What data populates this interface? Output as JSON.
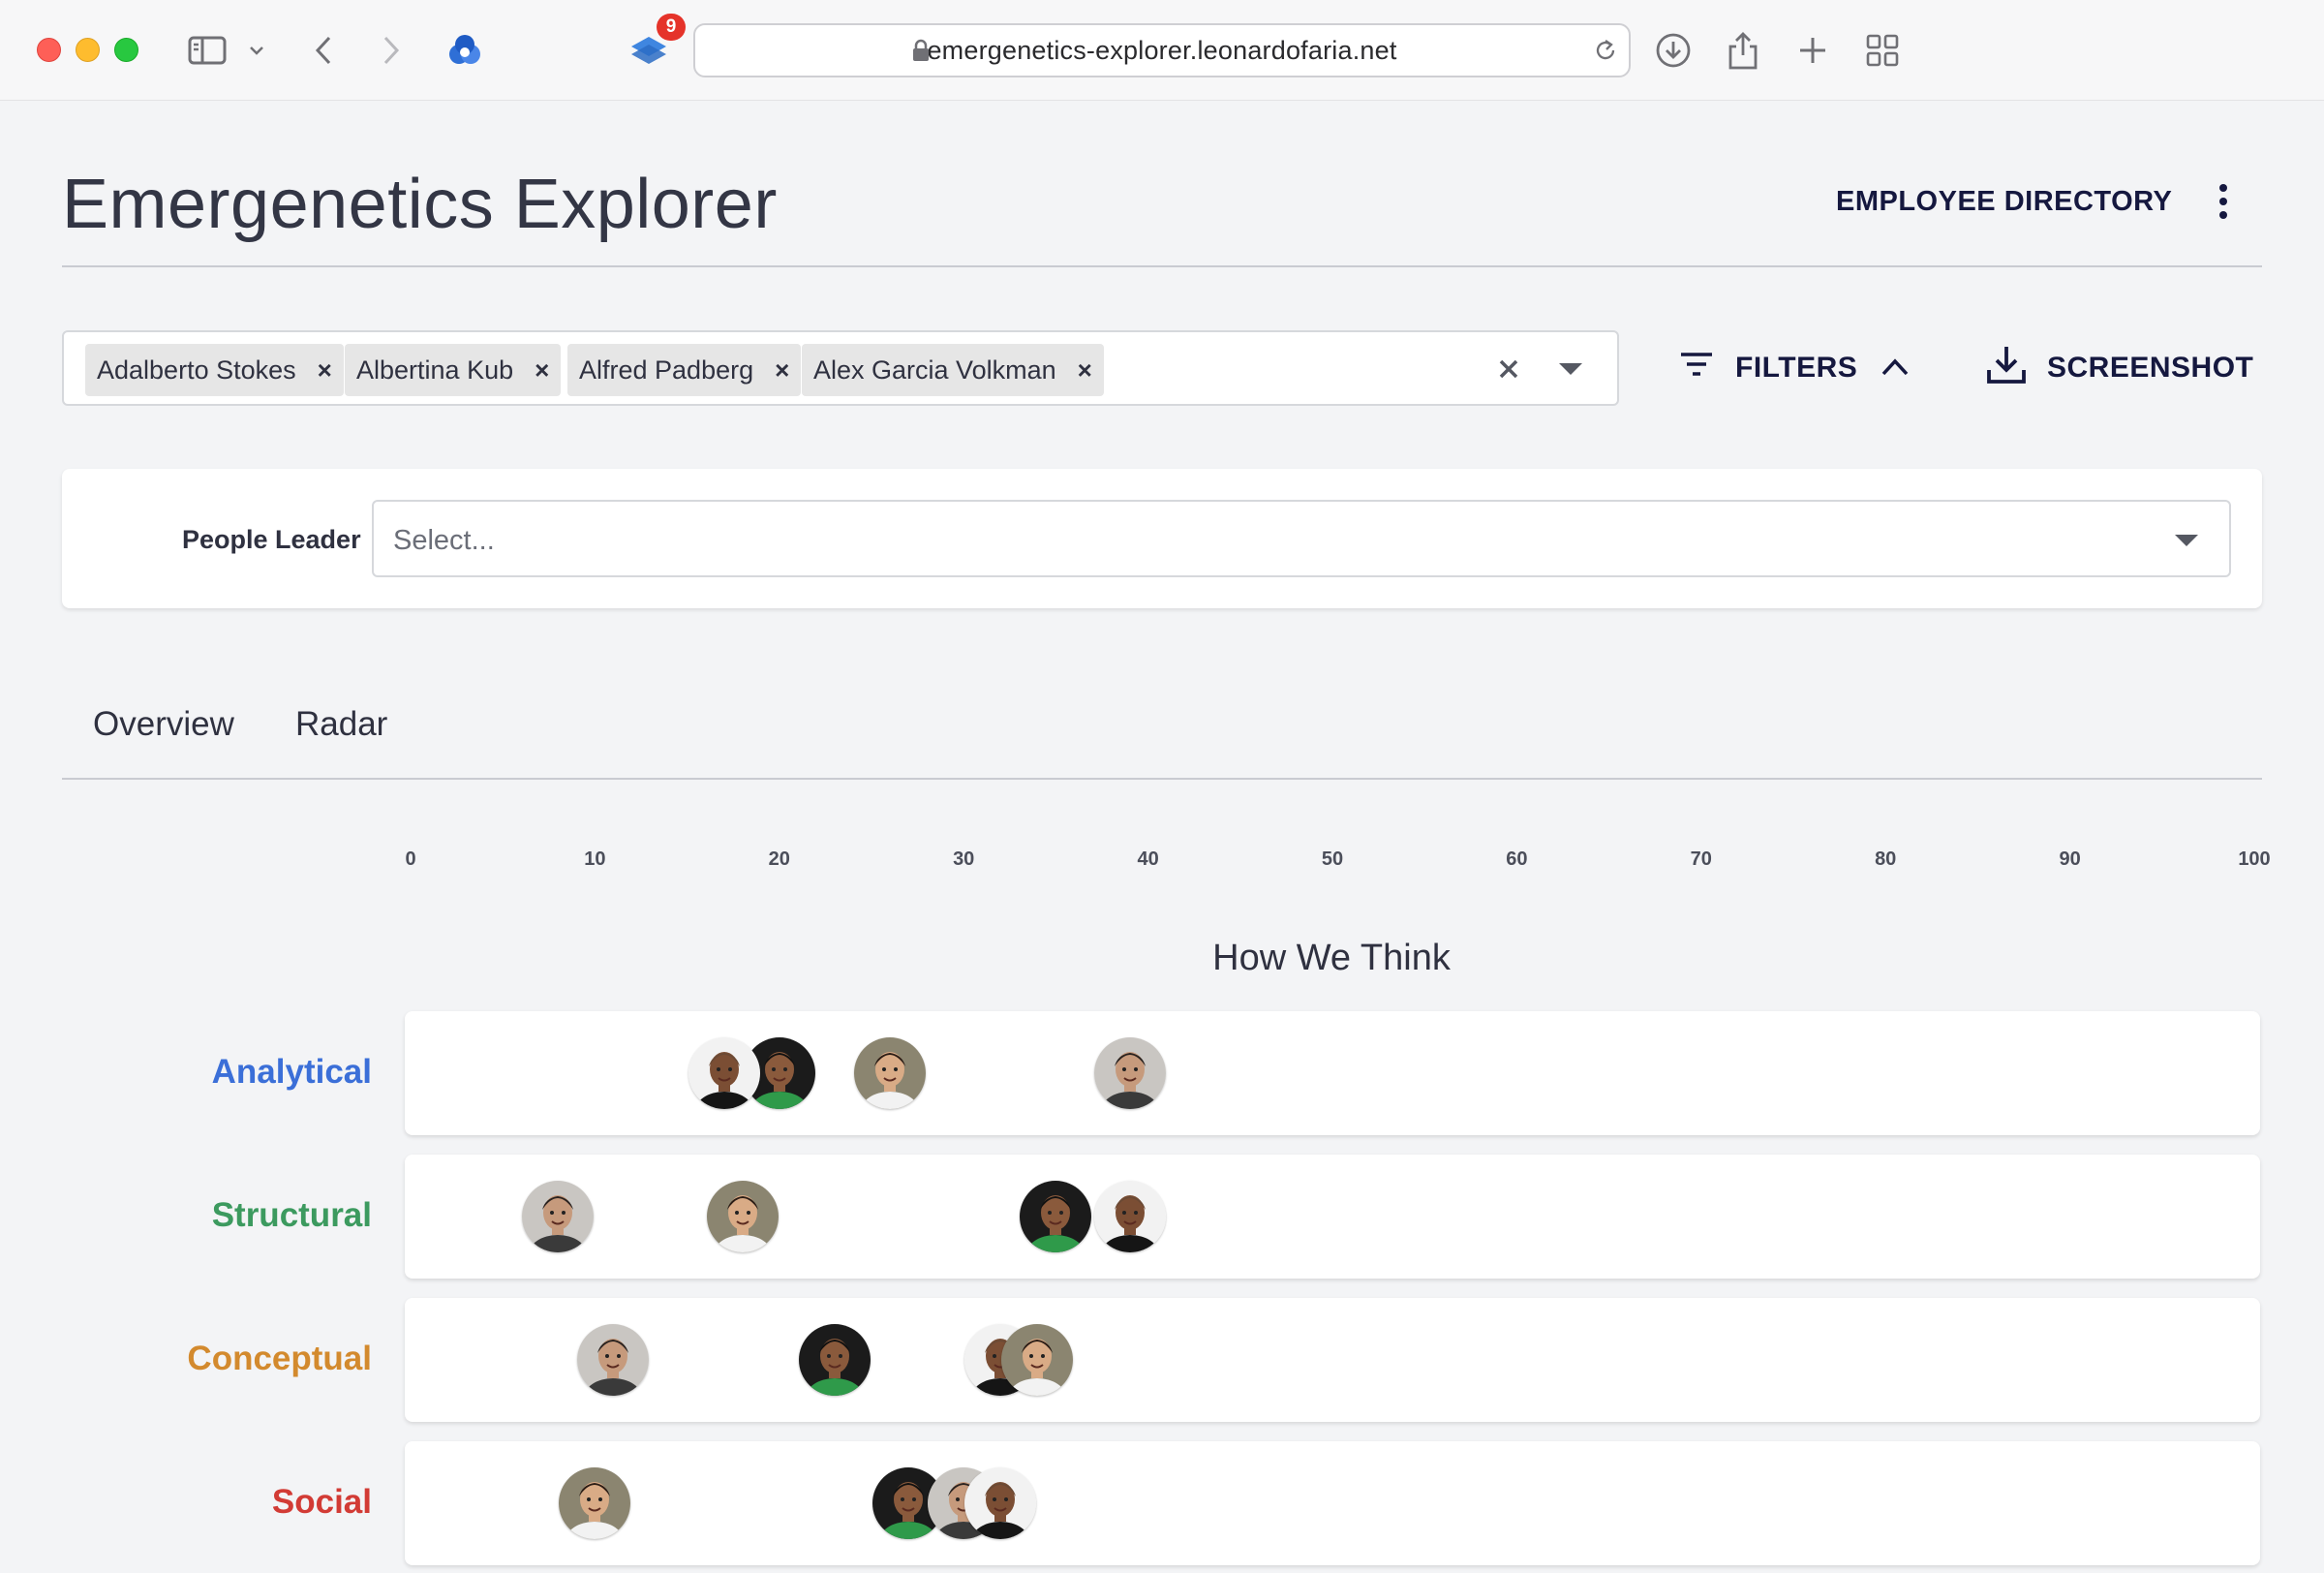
{
  "browser": {
    "url": "emergenetics-explorer.leonardofaria.net",
    "notification_count": "9"
  },
  "app": {
    "title": "Emergenetics Explorer",
    "nav_link": "EMPLOYEE DIRECTORY"
  },
  "selection": {
    "chips": [
      "Adalberto Stokes",
      "Albertina Kub",
      "Alfred Padberg",
      "Alex Garcia Volkman"
    ],
    "remove_symbol": "×"
  },
  "toolbar": {
    "filters_label": "FILTERS",
    "screenshot_label": "SCREENSHOT"
  },
  "filters": {
    "people_leader_label": "People Leader",
    "people_leader_placeholder": "Select..."
  },
  "tabs": [
    "Overview",
    "Radar"
  ],
  "colors": {
    "analytical": "#3b6fd8",
    "structural": "#3c9a5f",
    "conceptual": "#d38a2e",
    "social": "#d23b35",
    "brand_dark": "#15183f"
  },
  "chart_data": {
    "type": "scatter",
    "title": "How We Think",
    "xlim": [
      0,
      100
    ],
    "x_ticks": [
      "0",
      "10",
      "20",
      "30",
      "40",
      "50",
      "60",
      "70",
      "80",
      "90",
      "100"
    ],
    "categories": [
      "Analytical",
      "Structural",
      "Conceptual",
      "Social"
    ],
    "people": [
      "Adalberto Stokes",
      "Albertina Kub",
      "Alfred Padberg",
      "Alex Garcia Volkman"
    ],
    "series": [
      {
        "values": [
          20,
          39,
          17,
          26
        ]
      },
      {
        "values": [
          35,
          8,
          39,
          18
        ]
      },
      {
        "values": [
          23,
          11,
          32,
          34
        ]
      },
      {
        "values": [
          27,
          30,
          32,
          10
        ]
      }
    ]
  }
}
